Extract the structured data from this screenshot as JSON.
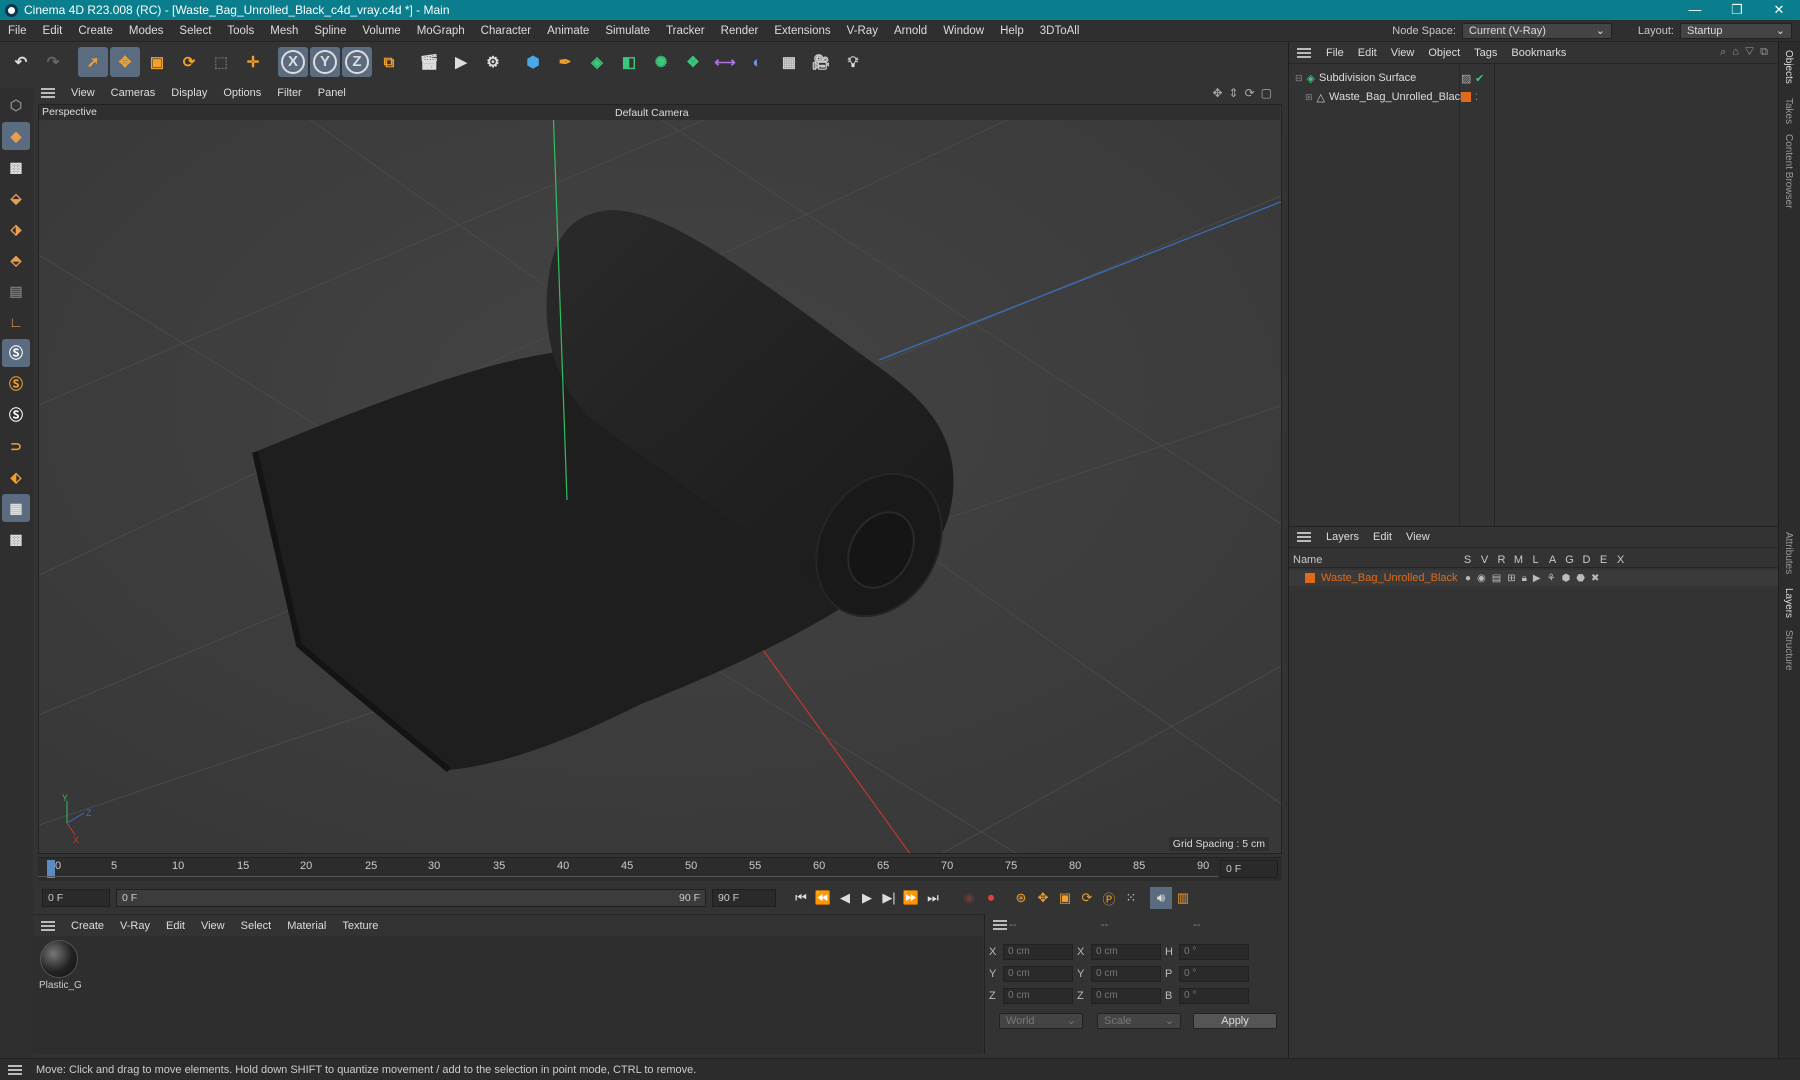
{
  "window": {
    "title": "Cinema 4D R23.008 (RC) - [Waste_Bag_Unrolled_Black_c4d_vray.c4d *] - Main",
    "min": "—",
    "max": "❐",
    "close": "✕"
  },
  "menubar": {
    "items": [
      "File",
      "Edit",
      "Create",
      "Modes",
      "Select",
      "Tools",
      "Mesh",
      "Spline",
      "Volume",
      "MoGraph",
      "Character",
      "Animate",
      "Simulate",
      "Tracker",
      "Render",
      "Extensions",
      "V-Ray",
      "Arnold",
      "Window",
      "Help",
      "3DToAll"
    ],
    "node_space_label": "Node Space:",
    "node_space_value": "Current (V-Ray)",
    "layout_label": "Layout:",
    "layout_value": "Startup"
  },
  "toolbar": {
    "axis_x": "X",
    "axis_y": "Y",
    "axis_z": "Z"
  },
  "viewport": {
    "menu": [
      "View",
      "Cameras",
      "Display",
      "Options",
      "Filter",
      "Panel"
    ],
    "label": "Perspective",
    "camera": "Default Camera",
    "grid_spacing": "Grid Spacing : 5 cm",
    "axis_y": "Y",
    "axis_z": "Z",
    "axis_x": "X"
  },
  "timeline": {
    "ticks": [
      "0",
      "5",
      "10",
      "15",
      "20",
      "25",
      "30",
      "35",
      "40",
      "45",
      "50",
      "55",
      "60",
      "65",
      "70",
      "75",
      "80",
      "85",
      "90"
    ],
    "current_frame": "0 F"
  },
  "playbar": {
    "start": "0 F",
    "range_start": "0 F",
    "range_end": "90 F",
    "end": "90 F"
  },
  "material_manager": {
    "menu": [
      "Create",
      "V-Ray",
      "Edit",
      "View",
      "Select",
      "Material",
      "Texture"
    ],
    "materials": [
      {
        "name": "Plastic_G"
      }
    ]
  },
  "coordinates": {
    "headers": [
      "--",
      "--",
      "--"
    ],
    "rows": [
      {
        "a": "X",
        "av": "0 cm",
        "b": "X",
        "bv": "0 cm",
        "c": "H",
        "cv": "0 °"
      },
      {
        "a": "Y",
        "av": "0 cm",
        "b": "Y",
        "bv": "0 cm",
        "c": "P",
        "cv": "0 °"
      },
      {
        "a": "Z",
        "av": "0 cm",
        "b": "Z",
        "bv": "0 cm",
        "c": "B",
        "cv": "0 °"
      }
    ],
    "mode1": "World",
    "mode2": "Scale",
    "apply": "Apply"
  },
  "objects": {
    "menu": [
      "File",
      "Edit",
      "View",
      "Object",
      "Tags",
      "Bookmarks"
    ],
    "items": [
      {
        "name": "Subdivision Surface"
      },
      {
        "name": "Waste_Bag_Unrolled_Black"
      }
    ]
  },
  "layers": {
    "menu": [
      "Layers",
      "Edit",
      "View"
    ],
    "col_name": "Name",
    "cols": [
      "S",
      "V",
      "R",
      "M",
      "L",
      "A",
      "G",
      "D",
      "E",
      "X"
    ],
    "items": [
      {
        "name": "Waste_Bag_Unrolled_Black",
        "color": "#e06a1a"
      }
    ]
  },
  "sidetabs": [
    "Objects",
    "Takes",
    "Content Browser",
    "Attributes",
    "Layers",
    "Structure"
  ],
  "status": "Move: Click and drag to move elements. Hold down SHIFT to quantize movement / add to the selection in point mode, CTRL to remove.",
  "colors": {
    "accent": "#e06a1a",
    "titlebar": "#0a7e8c",
    "selection": "#5b6b80"
  }
}
